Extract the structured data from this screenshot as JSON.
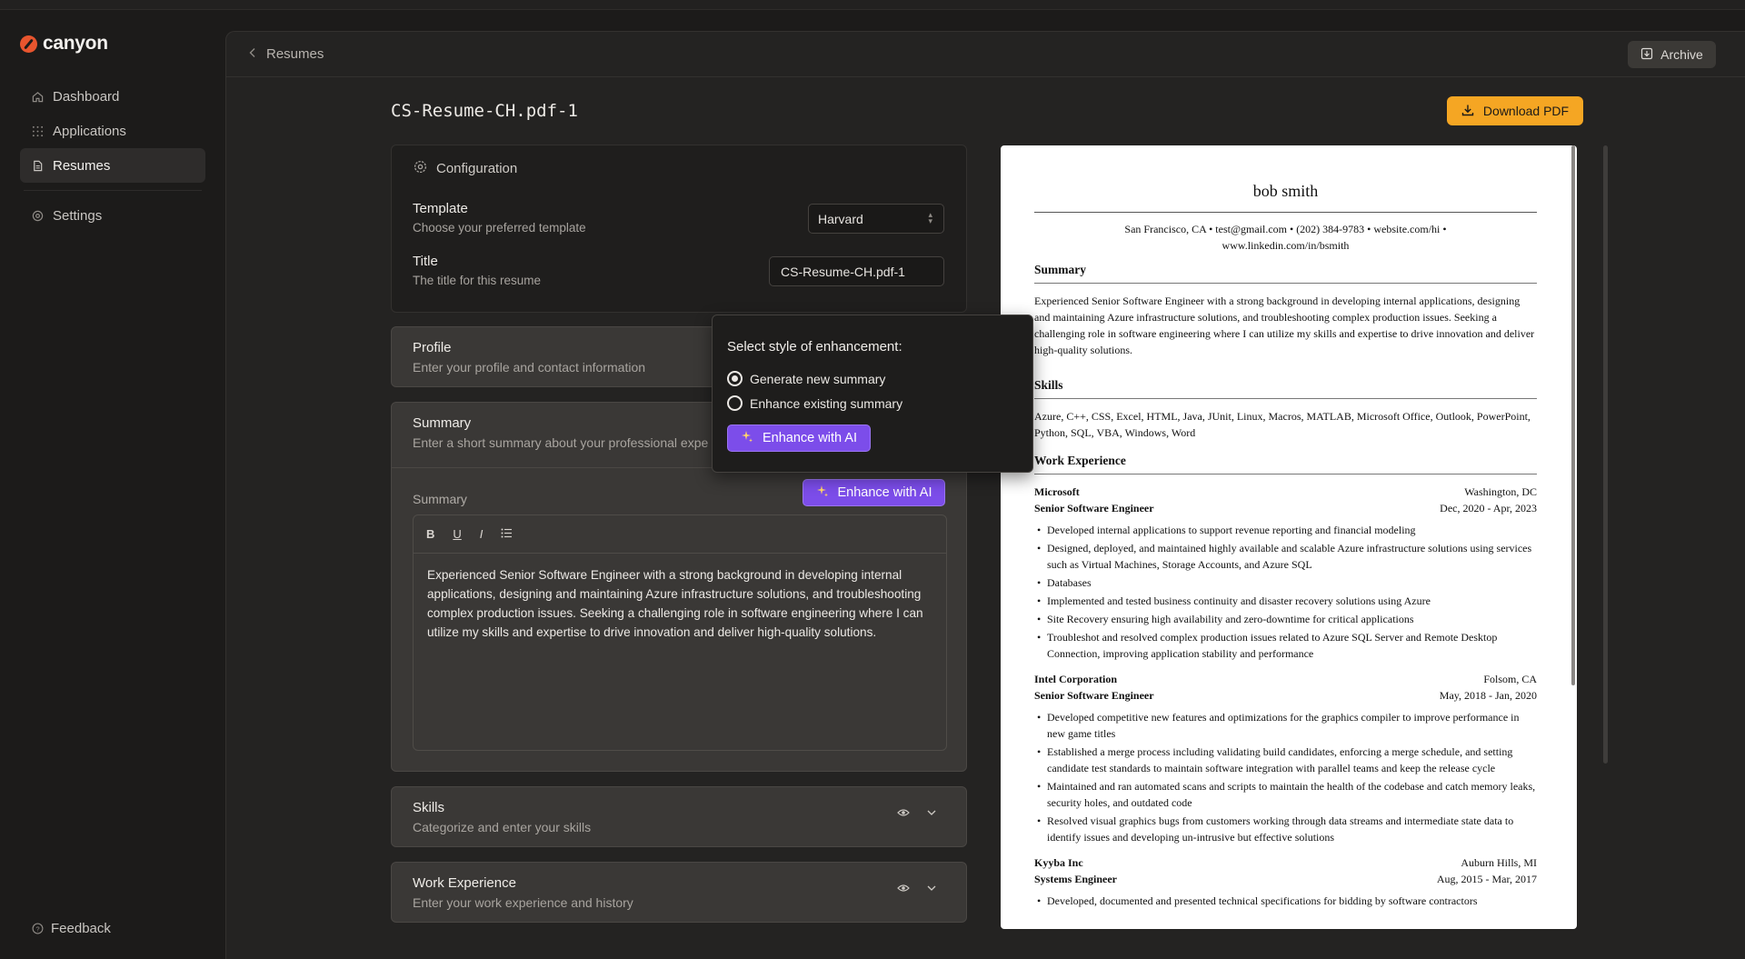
{
  "app": {
    "name": "canyon"
  },
  "sidebar": {
    "items": [
      {
        "label": "Dashboard",
        "icon": "home-icon"
      },
      {
        "label": "Applications",
        "icon": "grid-icon"
      },
      {
        "label": "Resumes",
        "icon": "file-icon",
        "active": true
      },
      {
        "label": "Settings",
        "icon": "gear-icon"
      }
    ],
    "feedback": "Feedback"
  },
  "header": {
    "breadcrumb": "Resumes",
    "archive_label": "Archive"
  },
  "page": {
    "title": "CS-Resume-CH.pdf-1",
    "download_label": "Download PDF"
  },
  "config": {
    "heading": "Configuration",
    "template_label": "Template",
    "template_sub": "Choose your preferred template",
    "template_value": "Harvard",
    "title_label": "Title",
    "title_sub": "The title for this resume",
    "title_value": "CS-Resume-CH.pdf-1"
  },
  "sections": {
    "profile": {
      "title": "Profile",
      "sub": "Enter your profile and contact information"
    },
    "summary": {
      "title": "Summary",
      "sub": "Enter a short summary about your professional expe",
      "field_label": "Summary",
      "enhance_label": "Enhance with AI",
      "toolbar": {
        "bold": "B",
        "underline": "U",
        "italic": "I"
      },
      "text": "Experienced Senior Software Engineer with a strong background in developing internal applications, designing and maintaining Azure infrastructure solutions, and troubleshooting complex production issues. Seeking a challenging role in software engineering where I can utilize my skills and expertise to drive innovation and deliver high-quality solutions."
    },
    "skills": {
      "title": "Skills",
      "sub": "Categorize and enter your skills"
    },
    "work": {
      "title": "Work Experience",
      "sub": "Enter your work experience and history"
    }
  },
  "popover": {
    "title": "Select style of enhancement:",
    "option1": "Generate new summary",
    "option2": "Enhance existing summary",
    "selected": "option1",
    "button": "Enhance with AI"
  },
  "resume": {
    "name": "bob smith",
    "contact_line1": "San Francisco, CA • test@gmail.com • (202) 384-9783 • website.com/hi •",
    "contact_line2": "www.linkedin.com/in/bsmith",
    "summary_heading": "Summary",
    "summary_text": "Experienced Senior Software Engineer with a strong background in developing internal applications, designing and maintaining Azure infrastructure solutions, and troubleshooting complex production issues. Seeking a challenging role in software engineering where I can utilize my skills and expertise to drive innovation and deliver high-quality solutions.",
    "skills_heading": "Skills",
    "skills_text": "Azure, C++, CSS, Excel, HTML, Java, JUnit, Linux, Macros, MATLAB, Microsoft Office, Outlook, PowerPoint, Python, SQL, VBA, Windows, Word",
    "work_heading": "Work Experience",
    "jobs": [
      {
        "company": "Microsoft",
        "location": "Washington, DC",
        "role": "Senior Software Engineer",
        "dates": "Dec, 2020 - Apr, 2023",
        "bullets": [
          "Developed internal applications to support revenue reporting and financial modeling",
          "Designed, deployed, and maintained highly available and scalable Azure infrastructure solutions using services such as Virtual Machines, Storage Accounts, and Azure SQL",
          "Databases",
          "Implemented and tested business continuity and disaster recovery solutions using Azure",
          "Site Recovery ensuring high availability and zero-downtime for critical applications",
          "Troubleshot and resolved complex production issues related to Azure SQL Server and Remote Desktop Connection, improving application stability and performance"
        ]
      },
      {
        "company": "Intel Corporation",
        "location": "Folsom, CA",
        "role": "Senior Software Engineer",
        "dates": "May, 2018 - Jan, 2020",
        "bullets": [
          "Developed competitive new features and optimizations for the graphics compiler to improve performance in new game titles",
          "Established a merge process including validating build candidates, enforcing a merge schedule, and setting candidate test standards to maintain software integration with parallel teams and keep the release cycle",
          "Maintained and ran automated scans and scripts to maintain the health of the codebase and catch memory leaks, security holes, and outdated code",
          "Resolved visual graphics bugs from customers working through data streams and intermediate state data to identify issues and developing un-intrusive but effective solutions"
        ]
      },
      {
        "company": "Kyyba Inc",
        "location": "Auburn Hills, MI",
        "role": "Systems Engineer",
        "dates": "Aug, 2015 - Mar, 2017",
        "bullets": [
          "Developed, documented and presented technical specifications for bidding by software contractors"
        ]
      }
    ]
  }
}
